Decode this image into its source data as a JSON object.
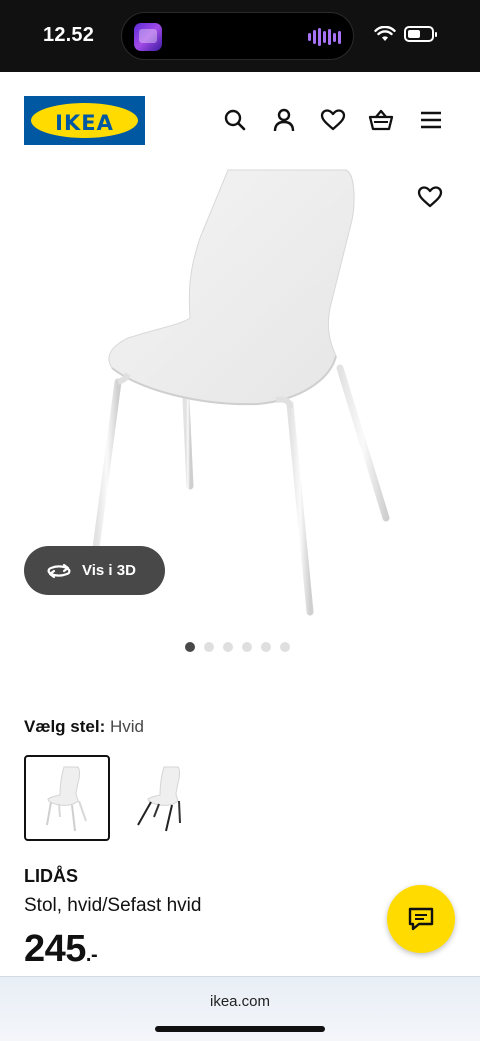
{
  "status_bar": {
    "time": "12.52"
  },
  "header": {
    "logo_text": "IKEA",
    "icons": [
      "search-icon",
      "profile-icon",
      "heart-icon",
      "basket-icon",
      "menu-icon"
    ]
  },
  "product_image": {
    "view_3d_label": "Vis i 3D",
    "carousel": {
      "total": 6,
      "active_index": 0
    }
  },
  "variant": {
    "label": "Vælg stel:",
    "value": "Hvid",
    "options": [
      "white-frame",
      "black-frame"
    ],
    "selected_index": 0
  },
  "product": {
    "name": "LIDÅS",
    "description": "Stol, hvid/Sefast hvid",
    "price": "245",
    "price_suffix": ".-"
  },
  "browser": {
    "url": "ikea.com"
  },
  "colors": {
    "ikea_blue": "#0058a3",
    "ikea_yellow": "#ffdb00",
    "button_dark": "#484848"
  }
}
